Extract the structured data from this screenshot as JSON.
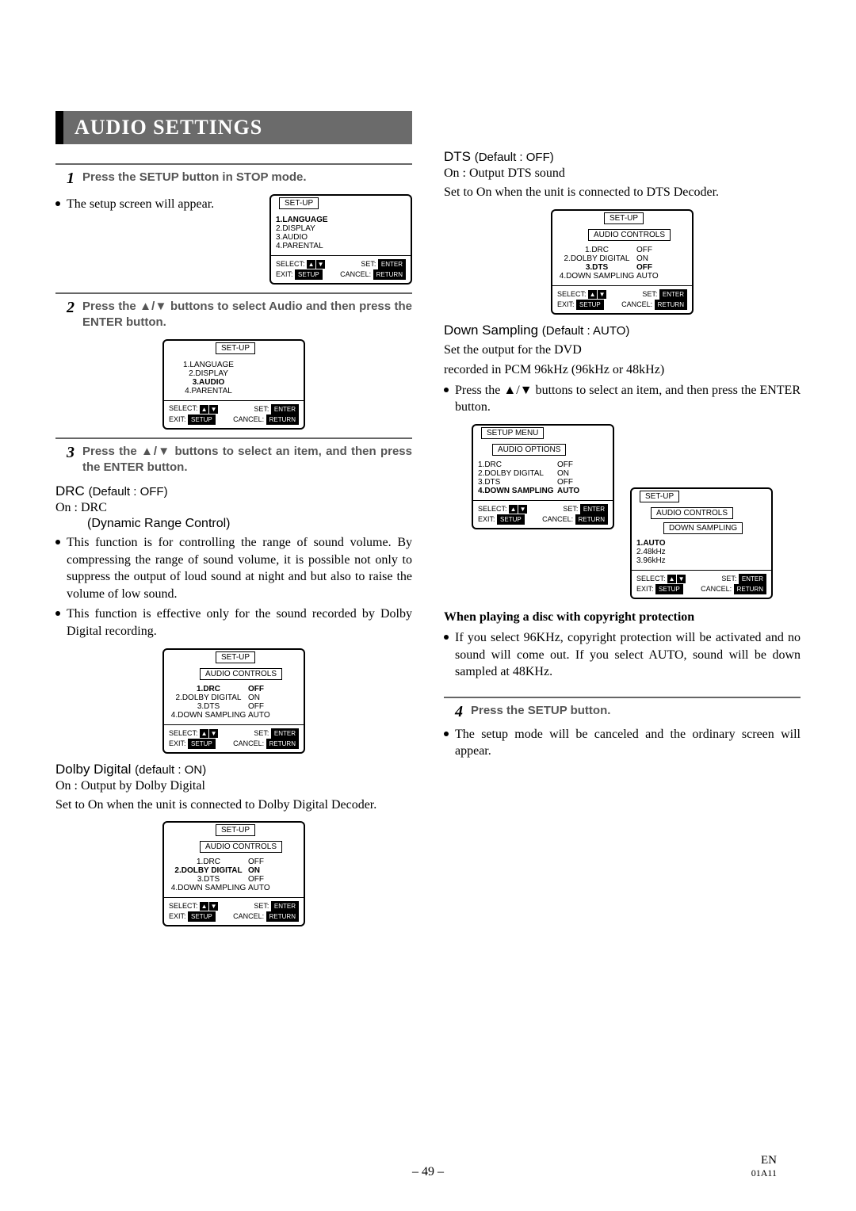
{
  "page_title": "AUDIO SETTINGS",
  "steps": {
    "s1": "Press the SETUP button in STOP mode.",
    "s2": "Press the ▲/▼ buttons to select Audio and then press the ENTER button.",
    "s3": "Press the ▲/▼ buttons to select an item, and then press the ENTER button.",
    "s4": "Press the SETUP button."
  },
  "after_s1": "The setup screen will appear.",
  "drc": {
    "head": "DRC",
    "def": "(Default : OFF)",
    "line1": "On : DRC",
    "line2": "(Dynamic Range Control)",
    "p1": "This function is for controlling the range of sound volume. By compressing the range of sound volume, it is possible not only to suppress the output of loud sound at night and but also to raise the volume of low sound.",
    "p2": "This function is effective only for the sound recorded by Dolby Digital recording."
  },
  "dolby": {
    "head": "Dolby Digital",
    "def": "(default : ON)",
    "line1": "On : Output by Dolby Digital",
    "p1": "Set to On when the unit is connected to Dolby Digital Decoder."
  },
  "dts": {
    "head": "DTS",
    "def": "(Default : OFF)",
    "line1": "On : Output DTS sound",
    "p1": "Set to On when the unit is connected to DTS Decoder."
  },
  "down": {
    "head": "Down Sampling",
    "def": "(Default : AUTO)",
    "p1": "Set the output for the DVD",
    "p2": "recorded in PCM 96kHz (96kHz or 48kHz)",
    "bul": "Press the ▲/▼ buttons to select an item, and then press the ENTER button."
  },
  "copyright": {
    "head": "When playing a disc with copyright  protection",
    "p": "If you select 96KHz, copyright protection will be activated and no sound will come out. If you select AUTO, sound will be down sampled at 48KHz."
  },
  "after_s4": "The setup mode will be canceled and the ordinary screen will appear.",
  "osd": {
    "setup_title": "SET-UP",
    "setup_menu_title": "SETUP MENU",
    "audio_controls": "AUDIO CONTROLS",
    "audio_options": "AUDIO OPTIONS",
    "down_sampling_sub": "DOWN SAMPLING",
    "main_items": {
      "i1": "1.LANGUAGE",
      "i2": "2.DISPLAY",
      "i3": "3.AUDIO",
      "i4": "4.PARENTAL"
    },
    "audio_items": {
      "i1": "1.DRC",
      "i2": "2.DOLBY DIGITAL",
      "i3": "3.DTS",
      "i4": "4.DOWN SAMPLING"
    },
    "audio_vals": {
      "off": "OFF",
      "on": "ON",
      "auto": "AUTO"
    },
    "ds_items": {
      "i1": "1.AUTO",
      "i2": "2.48kHz",
      "i3": "3.96kHz"
    },
    "foot": {
      "select": "SELECT:",
      "set": "SET:",
      "exit": "EXIT:",
      "cancel": "CANCEL:",
      "enter": "ENTER",
      "setup": "SETUP",
      "return": "RETURN"
    }
  },
  "footer": {
    "page": "– 49 –",
    "en": "EN",
    "code": "01A11"
  }
}
